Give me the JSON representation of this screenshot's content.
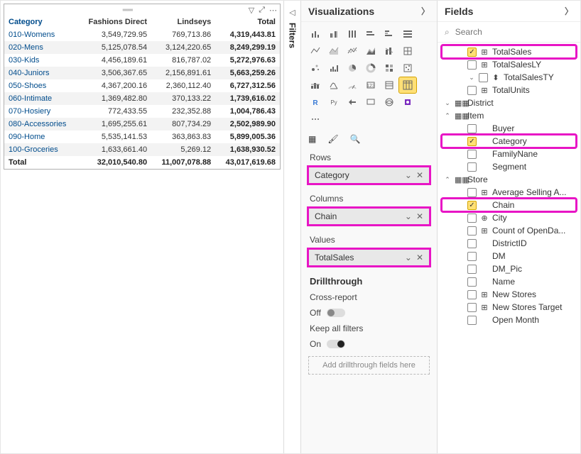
{
  "panes": {
    "filters": "Filters",
    "viz": "Visualizations",
    "fields": "Fields"
  },
  "search_placeholder": "Search",
  "matrix": {
    "columns": [
      "Category",
      "Fashions Direct",
      "Lindseys",
      "Total"
    ],
    "rows": [
      [
        "010-Womens",
        "3,549,729.95",
        "769,713.86",
        "4,319,443.81"
      ],
      [
        "020-Mens",
        "5,125,078.54",
        "3,124,220.65",
        "8,249,299.19"
      ],
      [
        "030-Kids",
        "4,456,189.61",
        "816,787.02",
        "5,272,976.63"
      ],
      [
        "040-Juniors",
        "3,506,367.65",
        "2,156,891.61",
        "5,663,259.26"
      ],
      [
        "050-Shoes",
        "4,367,200.16",
        "2,360,112.40",
        "6,727,312.56"
      ],
      [
        "060-Intimate",
        "1,369,482.80",
        "370,133.22",
        "1,739,616.02"
      ],
      [
        "070-Hosiery",
        "772,433.55",
        "232,352.88",
        "1,004,786.43"
      ],
      [
        "080-Accessories",
        "1,695,255.61",
        "807,734.29",
        "2,502,989.90"
      ],
      [
        "090-Home",
        "5,535,141.53",
        "363,863.83",
        "5,899,005.36"
      ],
      [
        "100-Groceries",
        "1,633,661.40",
        "5,269.12",
        "1,638,930.52"
      ]
    ],
    "total_row": [
      "Total",
      "32,010,540.80",
      "11,007,078.88",
      "43,017,619.68"
    ]
  },
  "wells": {
    "rows_label": "Rows",
    "rows_value": "Category",
    "cols_label": "Columns",
    "cols_value": "Chain",
    "vals_label": "Values",
    "vals_value": "TotalSales"
  },
  "drill": {
    "header": "Drillthrough",
    "cross": "Cross-report",
    "cross_state": "Off",
    "keep": "Keep all filters",
    "keep_state": "On",
    "add": "Add drillthrough fields here"
  },
  "field_tree": [
    {
      "type": "leaf",
      "indent": 2,
      "checked": true,
      "icon": "calc",
      "label": "TotalSales",
      "hl": true
    },
    {
      "type": "leaf",
      "indent": 2,
      "checked": false,
      "icon": "calc",
      "label": "TotalSalesLY"
    },
    {
      "type": "leaf",
      "indent": 2,
      "checked": false,
      "icon": "hier",
      "label": "TotalSalesTY",
      "expander": "v"
    },
    {
      "type": "leaf",
      "indent": 2,
      "checked": false,
      "icon": "calc",
      "label": "TotalUnits"
    },
    {
      "type": "table",
      "indent": 0,
      "expander": "v",
      "icon": "table",
      "label": "District"
    },
    {
      "type": "table",
      "indent": 0,
      "expander": "^",
      "icon": "table",
      "label": "Item",
      "mark": true
    },
    {
      "type": "leaf",
      "indent": 2,
      "checked": false,
      "icon": "",
      "label": "Buyer"
    },
    {
      "type": "leaf",
      "indent": 2,
      "checked": true,
      "icon": "",
      "label": "Category",
      "hl": true
    },
    {
      "type": "leaf",
      "indent": 2,
      "checked": false,
      "icon": "",
      "label": "FamilyNane"
    },
    {
      "type": "leaf",
      "indent": 2,
      "checked": false,
      "icon": "",
      "label": "Segment"
    },
    {
      "type": "table",
      "indent": 0,
      "expander": "^",
      "icon": "table",
      "label": "Store",
      "mark": true
    },
    {
      "type": "leaf",
      "indent": 2,
      "checked": false,
      "icon": "calc",
      "label": "Average Selling A..."
    },
    {
      "type": "leaf",
      "indent": 2,
      "checked": true,
      "icon": "",
      "label": "Chain",
      "hl": true
    },
    {
      "type": "leaf",
      "indent": 2,
      "checked": false,
      "icon": "globe",
      "label": "City"
    },
    {
      "type": "leaf",
      "indent": 2,
      "checked": false,
      "icon": "calc",
      "label": "Count of OpenDa..."
    },
    {
      "type": "leaf",
      "indent": 2,
      "checked": false,
      "icon": "",
      "label": "DistrictID"
    },
    {
      "type": "leaf",
      "indent": 2,
      "checked": false,
      "icon": "",
      "label": "DM"
    },
    {
      "type": "leaf",
      "indent": 2,
      "checked": false,
      "icon": "",
      "label": "DM_Pic"
    },
    {
      "type": "leaf",
      "indent": 2,
      "checked": false,
      "icon": "",
      "label": "Name"
    },
    {
      "type": "leaf",
      "indent": 2,
      "checked": false,
      "icon": "calc",
      "label": "New Stores"
    },
    {
      "type": "leaf",
      "indent": 2,
      "checked": false,
      "icon": "calc",
      "label": "New Stores Target"
    },
    {
      "type": "leaf",
      "indent": 2,
      "checked": false,
      "icon": "",
      "label": "Open Month"
    }
  ]
}
